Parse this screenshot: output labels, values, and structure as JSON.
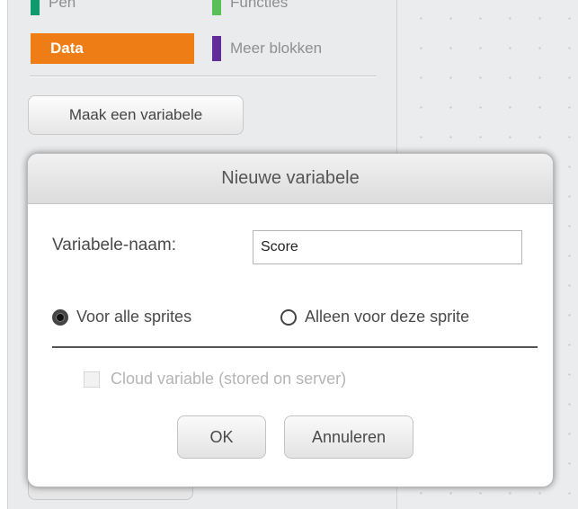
{
  "palette": {
    "categories": [
      {
        "label": "Pen",
        "color": "#0e9a6c"
      },
      {
        "label": "Functies",
        "color": "#59c059"
      },
      {
        "label": "Data",
        "color": "#ee7d16",
        "selected": true
      },
      {
        "label": "Meer blokken",
        "color": "#632d99"
      }
    ],
    "make_variable_label": "Maak een variabele"
  },
  "dialog": {
    "title": "Nieuwe variabele",
    "name_label": "Variabele-naam:",
    "name_value": "Score",
    "scope_options": [
      {
        "label": "Voor alle sprites",
        "checked": true
      },
      {
        "label": "Alleen voor deze sprite",
        "checked": false
      }
    ],
    "cloud_label": "Cloud variable (stored on server)",
    "cloud_checked": false,
    "cloud_enabled": false,
    "ok_label": "OK",
    "cancel_label": "Annuleren"
  }
}
